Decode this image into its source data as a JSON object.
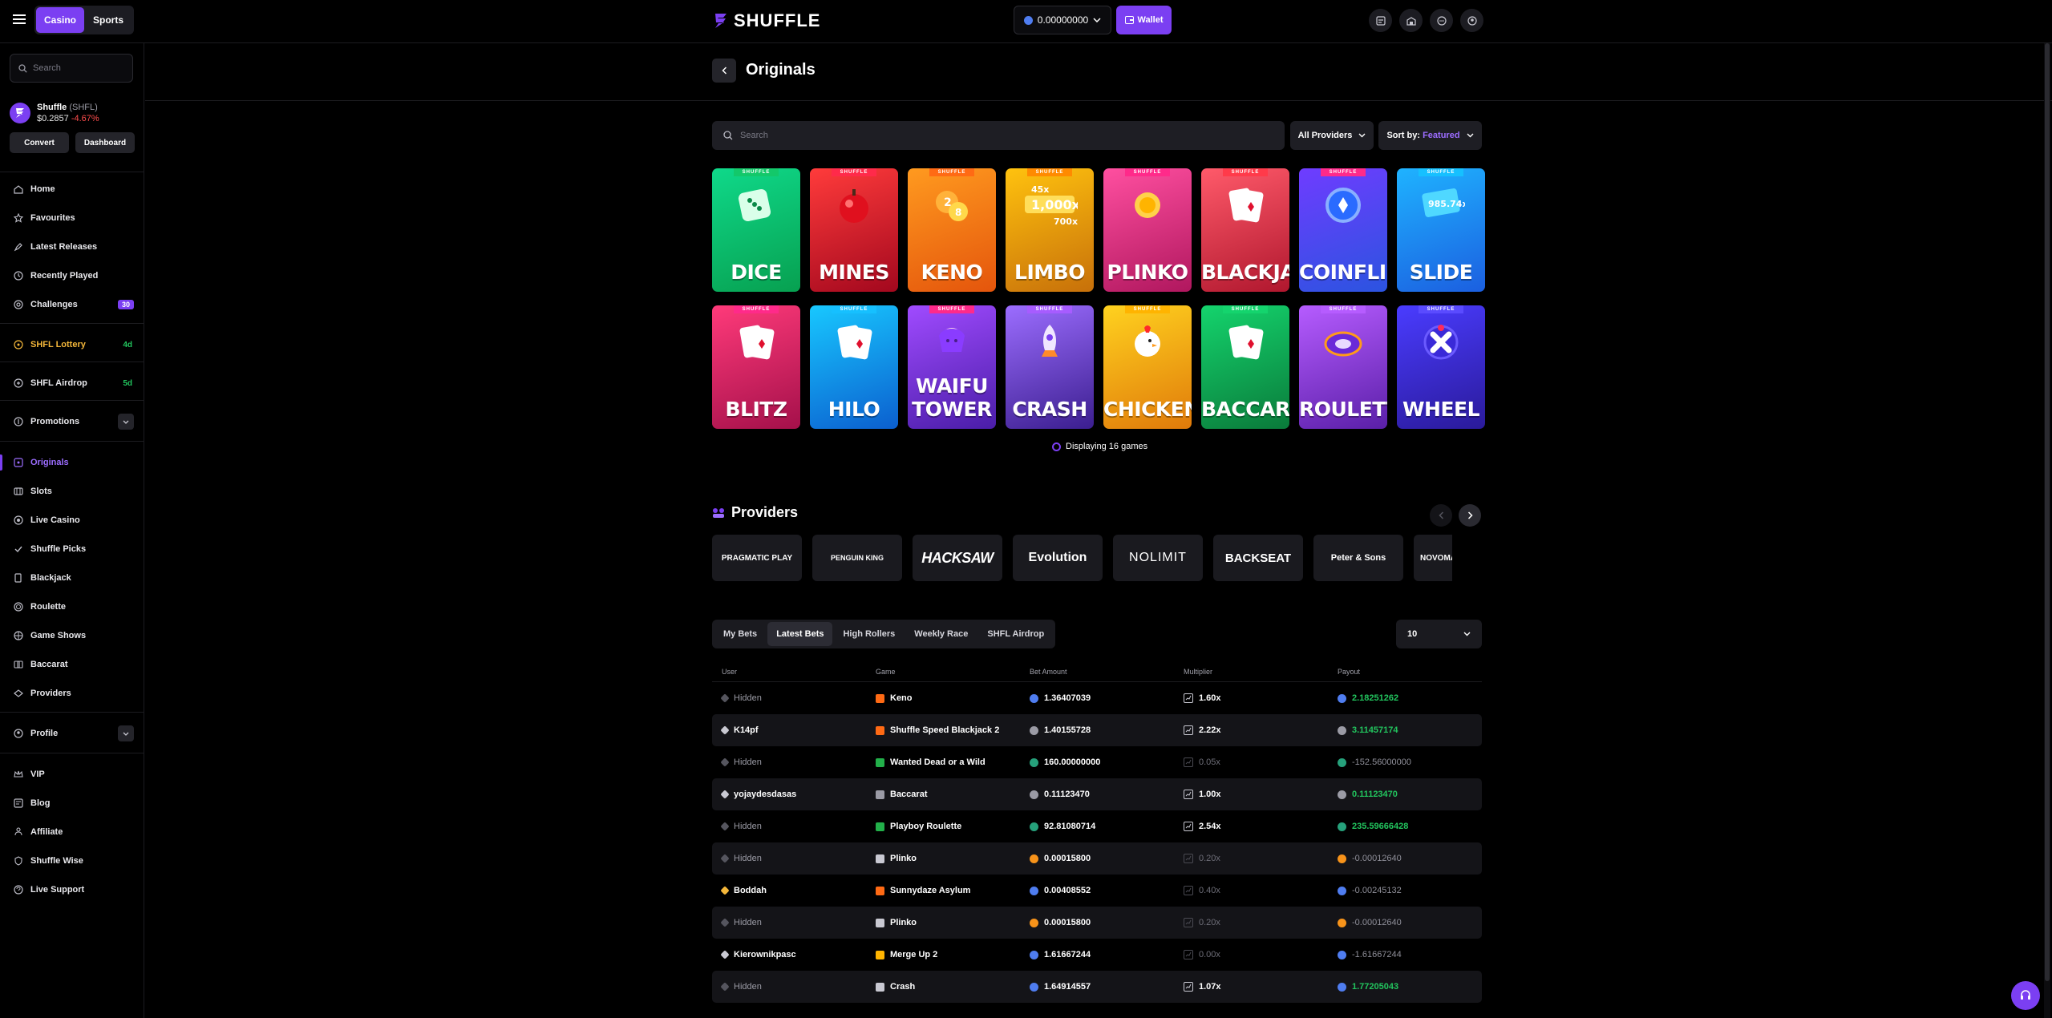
{
  "topbar": {
    "mode_tabs": [
      "Casino",
      "Sports"
    ],
    "logo_text": "SHUFFLE",
    "balance": "0.00000000",
    "wallet_label": "Wallet",
    "icons": [
      "tips-icon",
      "vault-icon",
      "chat-icon",
      "profile-icon"
    ]
  },
  "sidebar": {
    "search_placeholder": "Search",
    "token": {
      "name": "Shuffle",
      "symbol": "(SHFL)",
      "price": "$0.2857",
      "change": "-4.67%",
      "convert_label": "Convert",
      "dashboard_label": "Dashboard"
    },
    "nav": {
      "home": "Home",
      "favourites": "Favourites",
      "latest_releases": "Latest Releases",
      "recently_played": "Recently Played",
      "challenges": "Challenges",
      "challenges_count": "30",
      "lottery": "SHFL Lottery",
      "lottery_badge": "4d",
      "airdrop": "SHFL Airdrop",
      "airdrop_badge": "5d",
      "promotions": "Promotions",
      "originals": "Originals",
      "slots": "Slots",
      "live_casino": "Live Casino",
      "shuffle_picks": "Shuffle Picks",
      "blackjack": "Blackjack",
      "roulette": "Roulette",
      "game_shows": "Game Shows",
      "baccarat": "Baccarat",
      "providers": "Providers",
      "profile": "Profile",
      "vip": "VIP",
      "blog": "Blog",
      "affiliate": "Affiliate",
      "shuffle_wise": "Shuffle Wise",
      "live_support": "Live Support"
    }
  },
  "page": {
    "title": "Originals",
    "search_placeholder": "Search",
    "providers_filter": "All Providers",
    "sort_label": "Sort by:",
    "sort_value": "Featured",
    "game_tag": "SHUFFLE",
    "games": [
      "DICE",
      "MINES",
      "KENO",
      "LIMBO",
      "PLINKO",
      "BLACKJACK",
      "COINFLIP",
      "SLIDE",
      "BLITZ",
      "HILO",
      "WAIFU TOWER",
      "CRASH",
      "CHICKEN",
      "BACCARAT",
      "ROULETTE",
      "WHEEL"
    ],
    "display_count": "Displaying 16 games"
  },
  "providers": {
    "title": "Providers",
    "items": [
      "PRAGMATIC PLAY",
      "PENGUIN KING",
      "HACKSAW",
      "Evolution",
      "NOLIMIT",
      "BACKSEAT",
      "Peter & Sons",
      "NOVOMATIC"
    ]
  },
  "bets": {
    "tabs": [
      "My Bets",
      "Latest Bets",
      "High Rollers",
      "Weekly Race",
      "SHFL Airdrop"
    ],
    "rows_select": "10",
    "headers": [
      "User",
      "Game",
      "Bet Amount",
      "Multiplier",
      "Payout"
    ],
    "rows": [
      {
        "user": "Hidden",
        "game": "Keno",
        "bet": "1.36407039",
        "mult": "1.60x",
        "payout": "2.18251262"
      },
      {
        "user": "K14pf",
        "game": "Shuffle Speed Blackjack 2",
        "bet": "1.40155728",
        "mult": "2.22x",
        "payout": "3.11457174"
      },
      {
        "user": "Hidden",
        "game": "Wanted Dead or a Wild",
        "bet": "160.00000000",
        "mult": "0.05x",
        "payout": "-152.56000000"
      },
      {
        "user": "yojaydesdasas",
        "game": "Baccarat",
        "bet": "0.11123470",
        "mult": "1.00x",
        "payout": "0.11123470"
      },
      {
        "user": "Hidden",
        "game": "Playboy Roulette",
        "bet": "92.81080714",
        "mult": "2.54x",
        "payout": "235.59666428"
      },
      {
        "user": "Hidden",
        "game": "Plinko",
        "bet": "0.00015800",
        "mult": "0.20x",
        "payout": "-0.00012640"
      },
      {
        "user": "Boddah",
        "game": "Sunnydaze Asylum",
        "bet": "0.00408552",
        "mult": "0.40x",
        "payout": "-0.00245132"
      },
      {
        "user": "Hidden",
        "game": "Plinko",
        "bet": "0.00015800",
        "mult": "0.20x",
        "payout": "-0.00012640"
      },
      {
        "user": "Kierownikpasc",
        "game": "Merge Up 2",
        "bet": "1.61667244",
        "mult": "0.00x",
        "payout": "-1.61667244"
      },
      {
        "user": "Hidden",
        "game": "Crash",
        "bet": "1.64914557",
        "mult": "1.07x",
        "payout": "1.77205043"
      }
    ]
  },
  "colors": {
    "accent": "#7b3ff2",
    "positive": "#22c55e",
    "negative": "#ff4d4d",
    "gold": "#f4b73a"
  }
}
